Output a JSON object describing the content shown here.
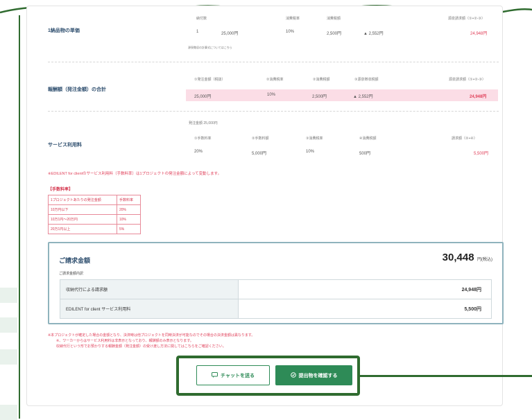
{
  "row_product": {
    "title": "1納品物の単価",
    "headers": [
      "納付数",
      "消費税率",
      "消費税額",
      "",
      "源泉請求額（①+②-③）"
    ],
    "values": [
      "1",
      "25,000円",
      "10%",
      "2,500円",
      "▲ 2,552円",
      "24,948円"
    ],
    "note": "源泉徴収の計算式についてはこちら"
  },
  "row_total": {
    "title": "報酬額（発注金額）の合計",
    "headers": [
      "①発注金額（税抜）",
      "②消費税率",
      "②消費税額",
      "③源泉徴収税額",
      "源泉請求額（①+②-③）"
    ],
    "values": [
      "25,000円",
      "10%",
      "2,500円",
      "▲ 2,552円",
      "24,948円"
    ]
  },
  "row_service": {
    "title": "サービス利用料",
    "base": "発注金額 25,000円",
    "headers": [
      "①手数料率",
      "②手数料額",
      "③消費税率",
      "④消費税額",
      "請求額（②+④）"
    ],
    "values": [
      "20%",
      "5,000円",
      "10%",
      "500円",
      "5,500円"
    ]
  },
  "service_note": "※EDILENT for clientのサービス利用料（手数料率）は1プロジェクトの発注金額によって変動します。",
  "fees": {
    "title": "【手数料率】",
    "header": [
      "1プロジェクトあたりの発注金額",
      "手数料率"
    ],
    "rows": [
      [
        "10万円以下",
        "20%"
      ],
      [
        "10万1円〜20万円",
        "10%"
      ],
      [
        "20万1円以上",
        "5%"
      ]
    ]
  },
  "summary": {
    "title": "ご請求金額",
    "amount": "30,448",
    "unit": "円(税込)",
    "breakdown_label": "ご請求金額内訳",
    "lines": [
      {
        "label": "収納代行による請求額",
        "value": "24,948円"
      },
      {
        "label": "EDILENT for client サービス利用料",
        "value": "5,500円"
      }
    ]
  },
  "footnotes": [
    "※本プロジェクトが確定した場合の金額となり、決済時は他プロジェクトを同時決済が可能なのでその場合の決済金額は異なります。",
    "※、ワーカーからはサービス利用料は非表示となっており、報酬額のみ表示となります。",
    "収納代行という形でお預かりする報酬金額（発注金額）の受け渡し方法に関してはこちらをご確認ください。"
  ],
  "buttons": {
    "chat": "チャットを送る",
    "confirm": "提出物を確認する"
  },
  "colors": {
    "accent": "#2e8b57",
    "highlight": "#2f6b2f",
    "negative": "#e0405a",
    "pink_bg": "#fbdde6"
  }
}
